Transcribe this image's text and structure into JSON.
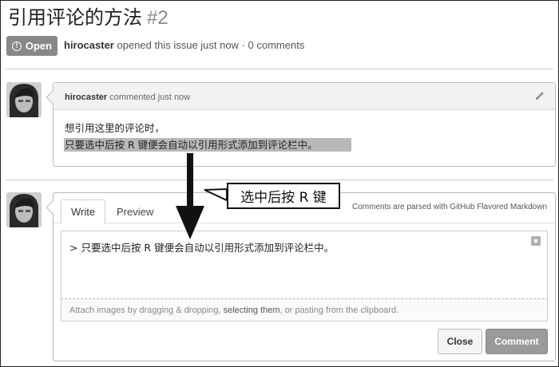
{
  "issue": {
    "title": "引用评论的方法",
    "number": "#2",
    "status": "Open",
    "author": "hirocaster",
    "meta_suffix": "opened this issue just now · 0 comments"
  },
  "comment": {
    "author": "hirocaster",
    "action": "commented just now",
    "line1": "想引用这里的评论时，",
    "line2": "只要选中后按 R 键便会自动以引用形式添加到评论栏中。"
  },
  "form": {
    "tabs": [
      "Write",
      "Preview"
    ],
    "markdown_note": "Comments are parsed with GitHub Flavored Markdown",
    "textarea_value": "> 只要选中后按 R 键便会自动以引用形式添加到评论栏中。",
    "attach_prefix": "Attach images by dragging & dropping, ",
    "attach_link": "selecting them",
    "attach_suffix": ", or pasting from the clipboard.",
    "close_label": "Close",
    "comment_label": "Comment"
  },
  "annotation": {
    "callout": "选中后按 R 键"
  },
  "icons": {
    "status": "info-circle-icon",
    "edit": "pencil-icon",
    "expand": "fullscreen-icon"
  }
}
